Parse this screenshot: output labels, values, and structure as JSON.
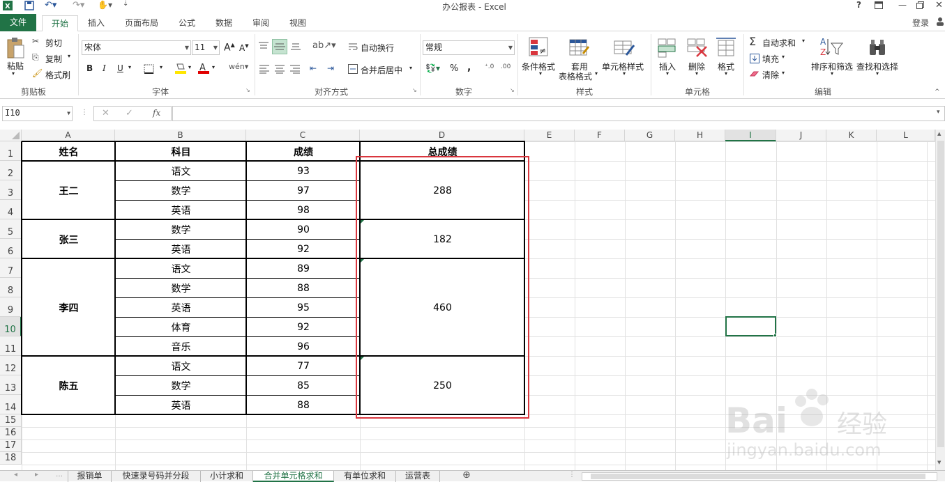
{
  "window": {
    "title": "办公报表 - Excel",
    "help": "?",
    "login": "登录"
  },
  "tabs": [
    "文件",
    "开始",
    "插入",
    "页面布局",
    "公式",
    "数据",
    "审阅",
    "视图"
  ],
  "ribbon": {
    "clipboard": {
      "paste": "粘贴",
      "cut": "剪切",
      "copy": "复制",
      "format_painter": "格式刷",
      "group": "剪贴板"
    },
    "font": {
      "name": "宋体",
      "size": "11",
      "bold": "B",
      "italic": "I",
      "underline": "U",
      "grow": "A",
      "shrink": "A",
      "group": "字体"
    },
    "alignment": {
      "wrap": "自动换行",
      "merge": "合并后居中",
      "group": "对齐方式"
    },
    "number": {
      "format": "常规",
      "percent": "%",
      "comma": ",",
      "group": "数字"
    },
    "styles": {
      "conditional": "条件格式",
      "table_format_1": "套用",
      "table_format_2": "表格格式",
      "cell_styles": "单元格样式",
      "group": "样式"
    },
    "cells": {
      "insert": "插入",
      "delete": "删除",
      "format": "格式",
      "group": "单元格"
    },
    "editing": {
      "autosum": "自动求和",
      "fill": "填充",
      "clear": "清除",
      "sort_filter": "排序和筛选",
      "find_select": "查找和选择",
      "group": "编辑"
    }
  },
  "formula_bar": {
    "name_box": "I10",
    "fx": "fx",
    "value": ""
  },
  "columns": [
    "A",
    "B",
    "C",
    "D",
    "E",
    "F",
    "G",
    "H",
    "I",
    "J",
    "K",
    "L"
  ],
  "rows": [
    "1",
    "2",
    "3",
    "4",
    "5",
    "6",
    "7",
    "8",
    "9",
    "10",
    "11",
    "12",
    "13",
    "14",
    "15",
    "16",
    "17",
    "18"
  ],
  "table": {
    "headers": [
      "姓名",
      "科目",
      "成绩",
      "总成绩"
    ],
    "groups": [
      {
        "name": "王二",
        "total": "288",
        "rows": [
          [
            "语文",
            "93"
          ],
          [
            "数学",
            "97"
          ],
          [
            "英语",
            "98"
          ]
        ]
      },
      {
        "name": "张三",
        "total": "182",
        "rows": [
          [
            "数学",
            "90"
          ],
          [
            "英语",
            "92"
          ]
        ]
      },
      {
        "name": "李四",
        "total": "460",
        "rows": [
          [
            "语文",
            "89"
          ],
          [
            "数学",
            "88"
          ],
          [
            "英语",
            "95"
          ],
          [
            "体育",
            "92"
          ],
          [
            "音乐",
            "96"
          ]
        ]
      },
      {
        "name": "陈五",
        "total": "250",
        "rows": [
          [
            "语文",
            "77"
          ],
          [
            "数学",
            "85"
          ],
          [
            "英语",
            "88"
          ]
        ]
      }
    ]
  },
  "highlight_color": "#d9363e",
  "accent": "#217346",
  "selected_cell": "I10",
  "sheet_tabs": [
    "报销单",
    "快速录号码并分段",
    "小计求和",
    "合并单元格求和",
    "有单位求和",
    "运营表"
  ],
  "active_sheet": "合并单元格求和",
  "watermark": {
    "brand": "Baidu经验",
    "url": "jingyan.baidu.com"
  }
}
